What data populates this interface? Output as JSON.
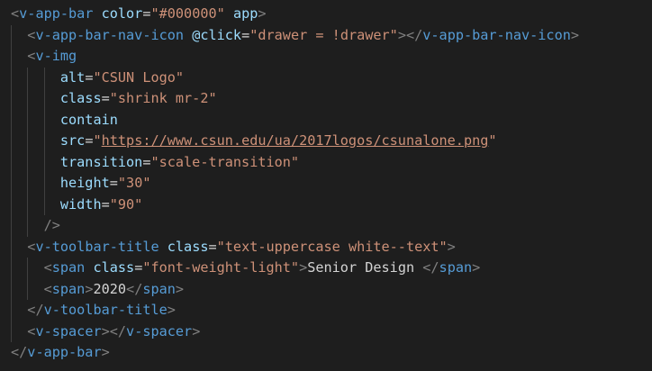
{
  "editor": {
    "colors": {
      "background": "#1e1e1e",
      "punctuation": "#808080",
      "tag": "#569cd6",
      "attribute": "#9cdcfe",
      "string": "#ce9178",
      "text": "#d4d4d4",
      "indent_guide": "#404040"
    },
    "lines": [
      {
        "indent": 0,
        "tokens": [
          {
            "t": "<",
            "c": "punct"
          },
          {
            "t": "v-app-bar",
            "c": "tag"
          },
          {
            "t": " ",
            "c": "text"
          },
          {
            "t": "color",
            "c": "attr"
          },
          {
            "t": "=",
            "c": "eq"
          },
          {
            "t": "\"#000000\"",
            "c": "str"
          },
          {
            "t": " ",
            "c": "text"
          },
          {
            "t": "app",
            "c": "attr"
          },
          {
            "t": ">",
            "c": "punct"
          }
        ]
      },
      {
        "indent": 1,
        "tokens": [
          {
            "t": "<",
            "c": "punct"
          },
          {
            "t": "v-app-bar-nav-icon",
            "c": "tag"
          },
          {
            "t": " ",
            "c": "text"
          },
          {
            "t": "@click",
            "c": "attr"
          },
          {
            "t": "=",
            "c": "eq"
          },
          {
            "t": "\"drawer = !drawer\"",
            "c": "str"
          },
          {
            "t": "></",
            "c": "punct"
          },
          {
            "t": "v-app-bar-nav-icon",
            "c": "tag"
          },
          {
            "t": ">",
            "c": "punct"
          }
        ]
      },
      {
        "indent": 1,
        "tokens": [
          {
            "t": "<",
            "c": "punct"
          },
          {
            "t": "v-img",
            "c": "tag"
          }
        ]
      },
      {
        "indent": 3,
        "tokens": [
          {
            "t": "alt",
            "c": "attr"
          },
          {
            "t": "=",
            "c": "eq"
          },
          {
            "t": "\"CSUN Logo\"",
            "c": "str"
          }
        ]
      },
      {
        "indent": 3,
        "tokens": [
          {
            "t": "class",
            "c": "attr"
          },
          {
            "t": "=",
            "c": "eq"
          },
          {
            "t": "\"shrink mr-2\"",
            "c": "str"
          }
        ]
      },
      {
        "indent": 3,
        "tokens": [
          {
            "t": "contain",
            "c": "attr"
          }
        ]
      },
      {
        "indent": 3,
        "tokens": [
          {
            "t": "src",
            "c": "attr"
          },
          {
            "t": "=",
            "c": "eq"
          },
          {
            "t": "\"",
            "c": "str"
          },
          {
            "t": "https://www.csun.edu/ua/2017logos/csunalone.png",
            "c": "link"
          },
          {
            "t": "\"",
            "c": "str"
          }
        ]
      },
      {
        "indent": 3,
        "tokens": [
          {
            "t": "transition",
            "c": "attr"
          },
          {
            "t": "=",
            "c": "eq"
          },
          {
            "t": "\"scale-transition\"",
            "c": "str"
          }
        ]
      },
      {
        "indent": 3,
        "tokens": [
          {
            "t": "height",
            "c": "attr"
          },
          {
            "t": "=",
            "c": "eq"
          },
          {
            "t": "\"30\"",
            "c": "str"
          }
        ]
      },
      {
        "indent": 3,
        "tokens": [
          {
            "t": "width",
            "c": "attr"
          },
          {
            "t": "=",
            "c": "eq"
          },
          {
            "t": "\"90\"",
            "c": "str"
          }
        ]
      },
      {
        "indent": 2,
        "tokens": [
          {
            "t": "/>",
            "c": "punct"
          }
        ]
      },
      {
        "indent": 1,
        "tokens": [
          {
            "t": "<",
            "c": "punct"
          },
          {
            "t": "v-toolbar-title",
            "c": "tag"
          },
          {
            "t": " ",
            "c": "text"
          },
          {
            "t": "class",
            "c": "attr"
          },
          {
            "t": "=",
            "c": "eq"
          },
          {
            "t": "\"text-uppercase white--text\"",
            "c": "str"
          },
          {
            "t": ">",
            "c": "punct"
          }
        ]
      },
      {
        "indent": 2,
        "tokens": [
          {
            "t": "<",
            "c": "punct"
          },
          {
            "t": "span",
            "c": "tag"
          },
          {
            "t": " ",
            "c": "text"
          },
          {
            "t": "class",
            "c": "attr"
          },
          {
            "t": "=",
            "c": "eq"
          },
          {
            "t": "\"font-weight-light\"",
            "c": "str"
          },
          {
            "t": ">",
            "c": "punct"
          },
          {
            "t": "Senior Design ",
            "c": "text"
          },
          {
            "t": "</",
            "c": "punct"
          },
          {
            "t": "span",
            "c": "tag"
          },
          {
            "t": ">",
            "c": "punct"
          }
        ]
      },
      {
        "indent": 2,
        "tokens": [
          {
            "t": "<",
            "c": "punct"
          },
          {
            "t": "span",
            "c": "tag"
          },
          {
            "t": ">",
            "c": "punct"
          },
          {
            "t": "2020",
            "c": "text"
          },
          {
            "t": "</",
            "c": "punct"
          },
          {
            "t": "span",
            "c": "tag"
          },
          {
            "t": ">",
            "c": "punct"
          }
        ]
      },
      {
        "indent": 1,
        "tokens": [
          {
            "t": "</",
            "c": "punct"
          },
          {
            "t": "v-toolbar-title",
            "c": "tag"
          },
          {
            "t": ">",
            "c": "punct"
          }
        ]
      },
      {
        "indent": 1,
        "tokens": [
          {
            "t": "<",
            "c": "punct"
          },
          {
            "t": "v-spacer",
            "c": "tag"
          },
          {
            "t": "></",
            "c": "punct"
          },
          {
            "t": "v-spacer",
            "c": "tag"
          },
          {
            "t": ">",
            "c": "punct"
          }
        ]
      },
      {
        "indent": 0,
        "tokens": [
          {
            "t": "</",
            "c": "punct"
          },
          {
            "t": "v-app-bar",
            "c": "tag"
          },
          {
            "t": ">",
            "c": "punct"
          }
        ]
      }
    ]
  }
}
